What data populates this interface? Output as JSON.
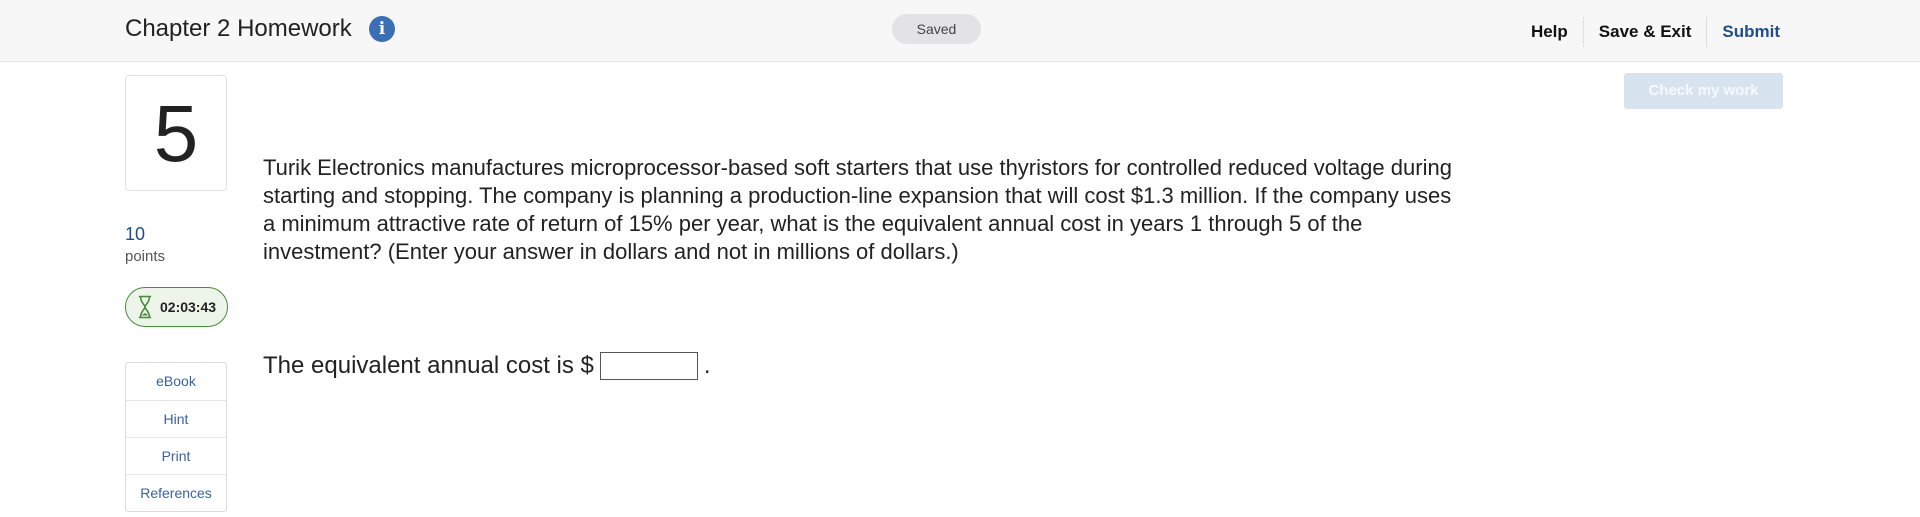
{
  "header": {
    "title": "Chapter 2 Homework",
    "info_icon": "i",
    "saved_label": "Saved",
    "nav": {
      "help": "Help",
      "save_exit": "Save & Exit",
      "submit": "Submit"
    }
  },
  "sidebar": {
    "question_number": "5",
    "points_value": "10",
    "points_label": "points",
    "timer": "02:03:43",
    "resources": [
      {
        "label": "eBook"
      },
      {
        "label": "Hint"
      },
      {
        "label": "Print"
      },
      {
        "label": "References"
      }
    ]
  },
  "main": {
    "check_button": "Check my work",
    "question_text": "Turik Electronics manufactures microprocessor-based soft starters that use thyristors for controlled reduced voltage during starting and stopping. The company is planning a production-line expansion that will cost $1.3 million. If the company uses a minimum attractive rate of return of 15% per year, what is the equivalent annual cost in years 1 through 5 of the investment? (Enter your answer in dollars and not in millions of dollars.)",
    "answer_prefix": "The equivalent annual cost is $",
    "answer_value": "",
    "answer_suffix": "."
  },
  "colors": {
    "accent": "#1f4d8f",
    "info_icon": "#3a6fb5",
    "timer_border": "#4a8a3c",
    "check_button_bg": "#d8e3f0"
  },
  "icons": {
    "info": "info-icon",
    "timer": "hourglass-icon"
  }
}
